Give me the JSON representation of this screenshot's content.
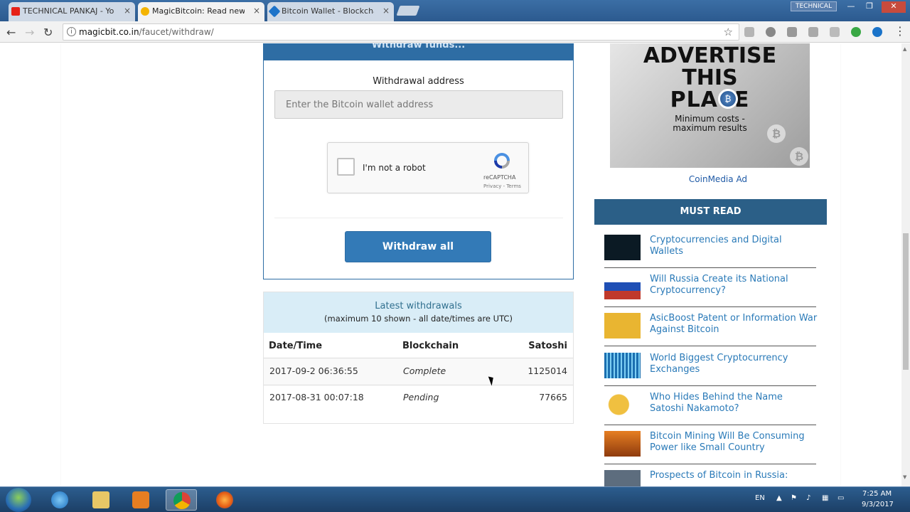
{
  "browser": {
    "tabs": [
      {
        "title": "TECHNICAL PANKAJ - Yo",
        "favicon_color": "#e62117",
        "active": false
      },
      {
        "title": "MagicBitcoin: Read news",
        "favicon_color": "#f4b400",
        "active": true
      },
      {
        "title": "Bitcoin Wallet - Blockcha",
        "favicon_color": "#1d73c9",
        "active": false
      }
    ],
    "tab_close_glyph": "×",
    "profile_badge": "TECHNICAL",
    "url_host": "magicbit.co.in",
    "url_path": "/faucet/withdraw/"
  },
  "withdraw": {
    "header": "Withdraw funds...",
    "address_label": "Withdrawal address",
    "address_placeholder": "Enter the Bitcoin wallet address",
    "captcha_label": "I'm not a robot",
    "captcha_brand": "reCAPTCHA",
    "captcha_terms": "Privacy - Terms",
    "button_label": "Withdraw all"
  },
  "latest": {
    "title": "Latest withdrawals",
    "subtitle": "(maximum 10 shown - all date/times are UTC)",
    "columns": [
      "Date/Time",
      "Blockchain",
      "Satoshi"
    ],
    "rows": [
      {
        "date": "2017-09-2 06:36:55",
        "status": "Complete",
        "satoshi": "1125014"
      },
      {
        "date": "2017-08-31 00:07:18",
        "status": "Pending",
        "satoshi": "77665"
      }
    ]
  },
  "sidebar": {
    "ad_lines": [
      "ADVERTISE",
      "THIS",
      "PLACE"
    ],
    "ad_tagline": [
      "Minimum costs -",
      "maximum results"
    ],
    "ad_caption": "CoinMedia Ad",
    "must_read_title": "MUST READ",
    "news": [
      {
        "title": "Cryptocurrencies and Digital Wallets",
        "thumb_color": "#0b1a24"
      },
      {
        "title": "Will Russia Create its National Cryptocurrency?",
        "thumb_color": "#c0392b"
      },
      {
        "title": "AsicBoost Patent or Information War Against Bitcoin",
        "thumb_color": "#e9b531"
      },
      {
        "title": "World Biggest Cryptocurrency Exchanges",
        "thumb_color": "#2a8bc9"
      },
      {
        "title": "Who Hides Behind the Name Satoshi Nakamoto?",
        "thumb_color": "#d9a520"
      },
      {
        "title": "Bitcoin Mining Will Be Consuming Power like Small Country",
        "thumb_color": "#d35400"
      },
      {
        "title": "Prospects of Bitcoin in Russia:",
        "thumb_color": "#5d6d7e"
      }
    ]
  },
  "taskbar": {
    "language": "EN",
    "time": "7:25 AM",
    "date": "9/3/2017"
  },
  "colors": {
    "primary": "#337ab7",
    "header_blue": "#2e6da4",
    "must_read_bg": "#2b5f87",
    "link": "#2a7ab8"
  }
}
